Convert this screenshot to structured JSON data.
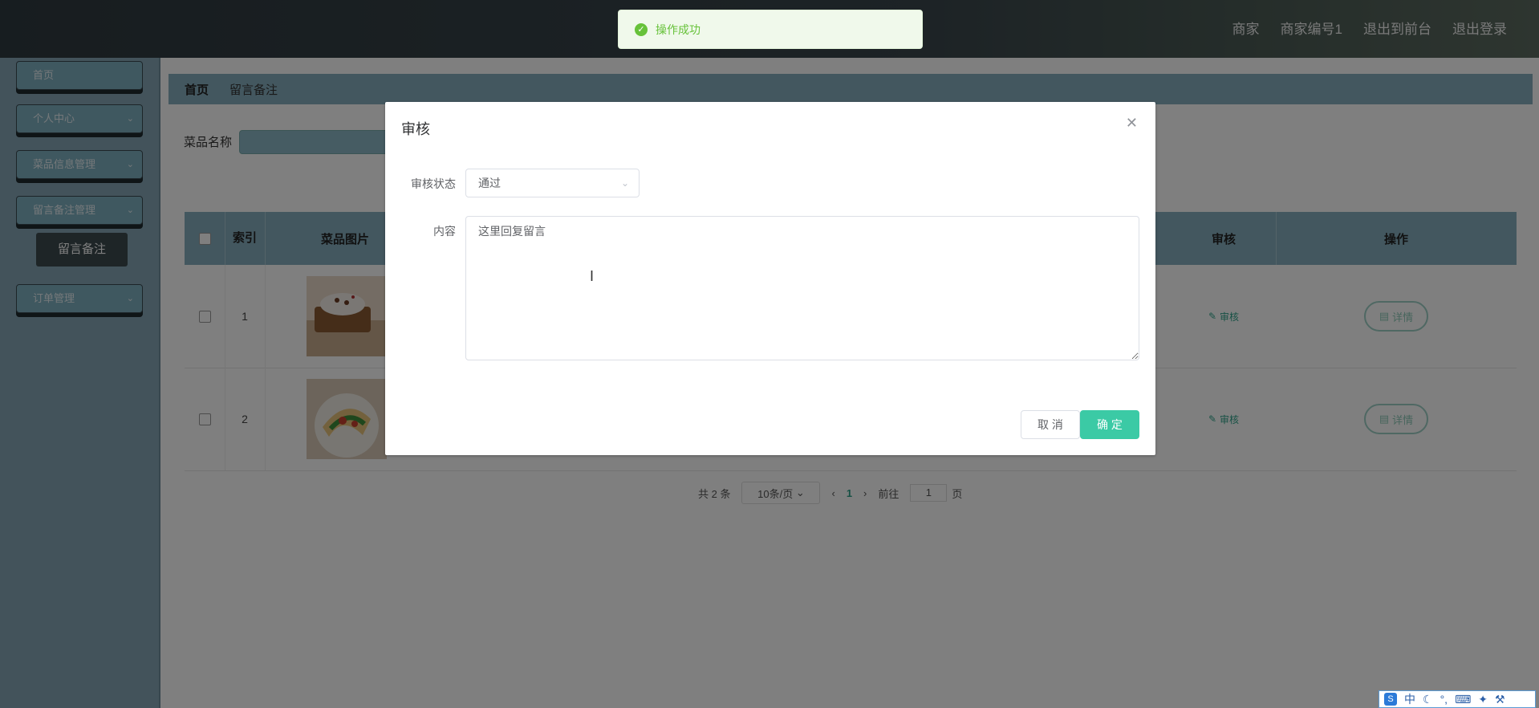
{
  "header": {
    "links": [
      "商家",
      "商家编号1",
      "退出到前台",
      "退出登录"
    ]
  },
  "sidebar": {
    "items": [
      {
        "label": "首页"
      },
      {
        "label": "个人中心"
      },
      {
        "label": "菜品信息管理"
      },
      {
        "label": "留言备注管理"
      },
      {
        "label": "订单管理"
      }
    ],
    "active_sub": "留言备注"
  },
  "breadcrumb": {
    "home": "首页",
    "current": "留言备注"
  },
  "search": {
    "label": "菜品名称"
  },
  "table": {
    "headers": {
      "index": "索引",
      "image": "菜品图片",
      "audit": "审核",
      "ops": "操作"
    },
    "rows": [
      {
        "index": "1",
        "audit": "审核",
        "detail": "详情"
      },
      {
        "index": "2",
        "audit": "审核",
        "detail": "详情"
      }
    ]
  },
  "pagination": {
    "total": "共 2 条",
    "size": "10条/页",
    "page": "1",
    "goto": "前往",
    "goto_value": "1",
    "page_unit": "页"
  },
  "toast": {
    "message": "操作成功"
  },
  "dialog": {
    "title": "审核",
    "status_label": "审核状态",
    "status_value": "通过",
    "content_label": "内容",
    "content_value": "这里回复留言",
    "cancel": "取 消",
    "confirm": "确 定"
  },
  "ime": {
    "lang": "中"
  }
}
